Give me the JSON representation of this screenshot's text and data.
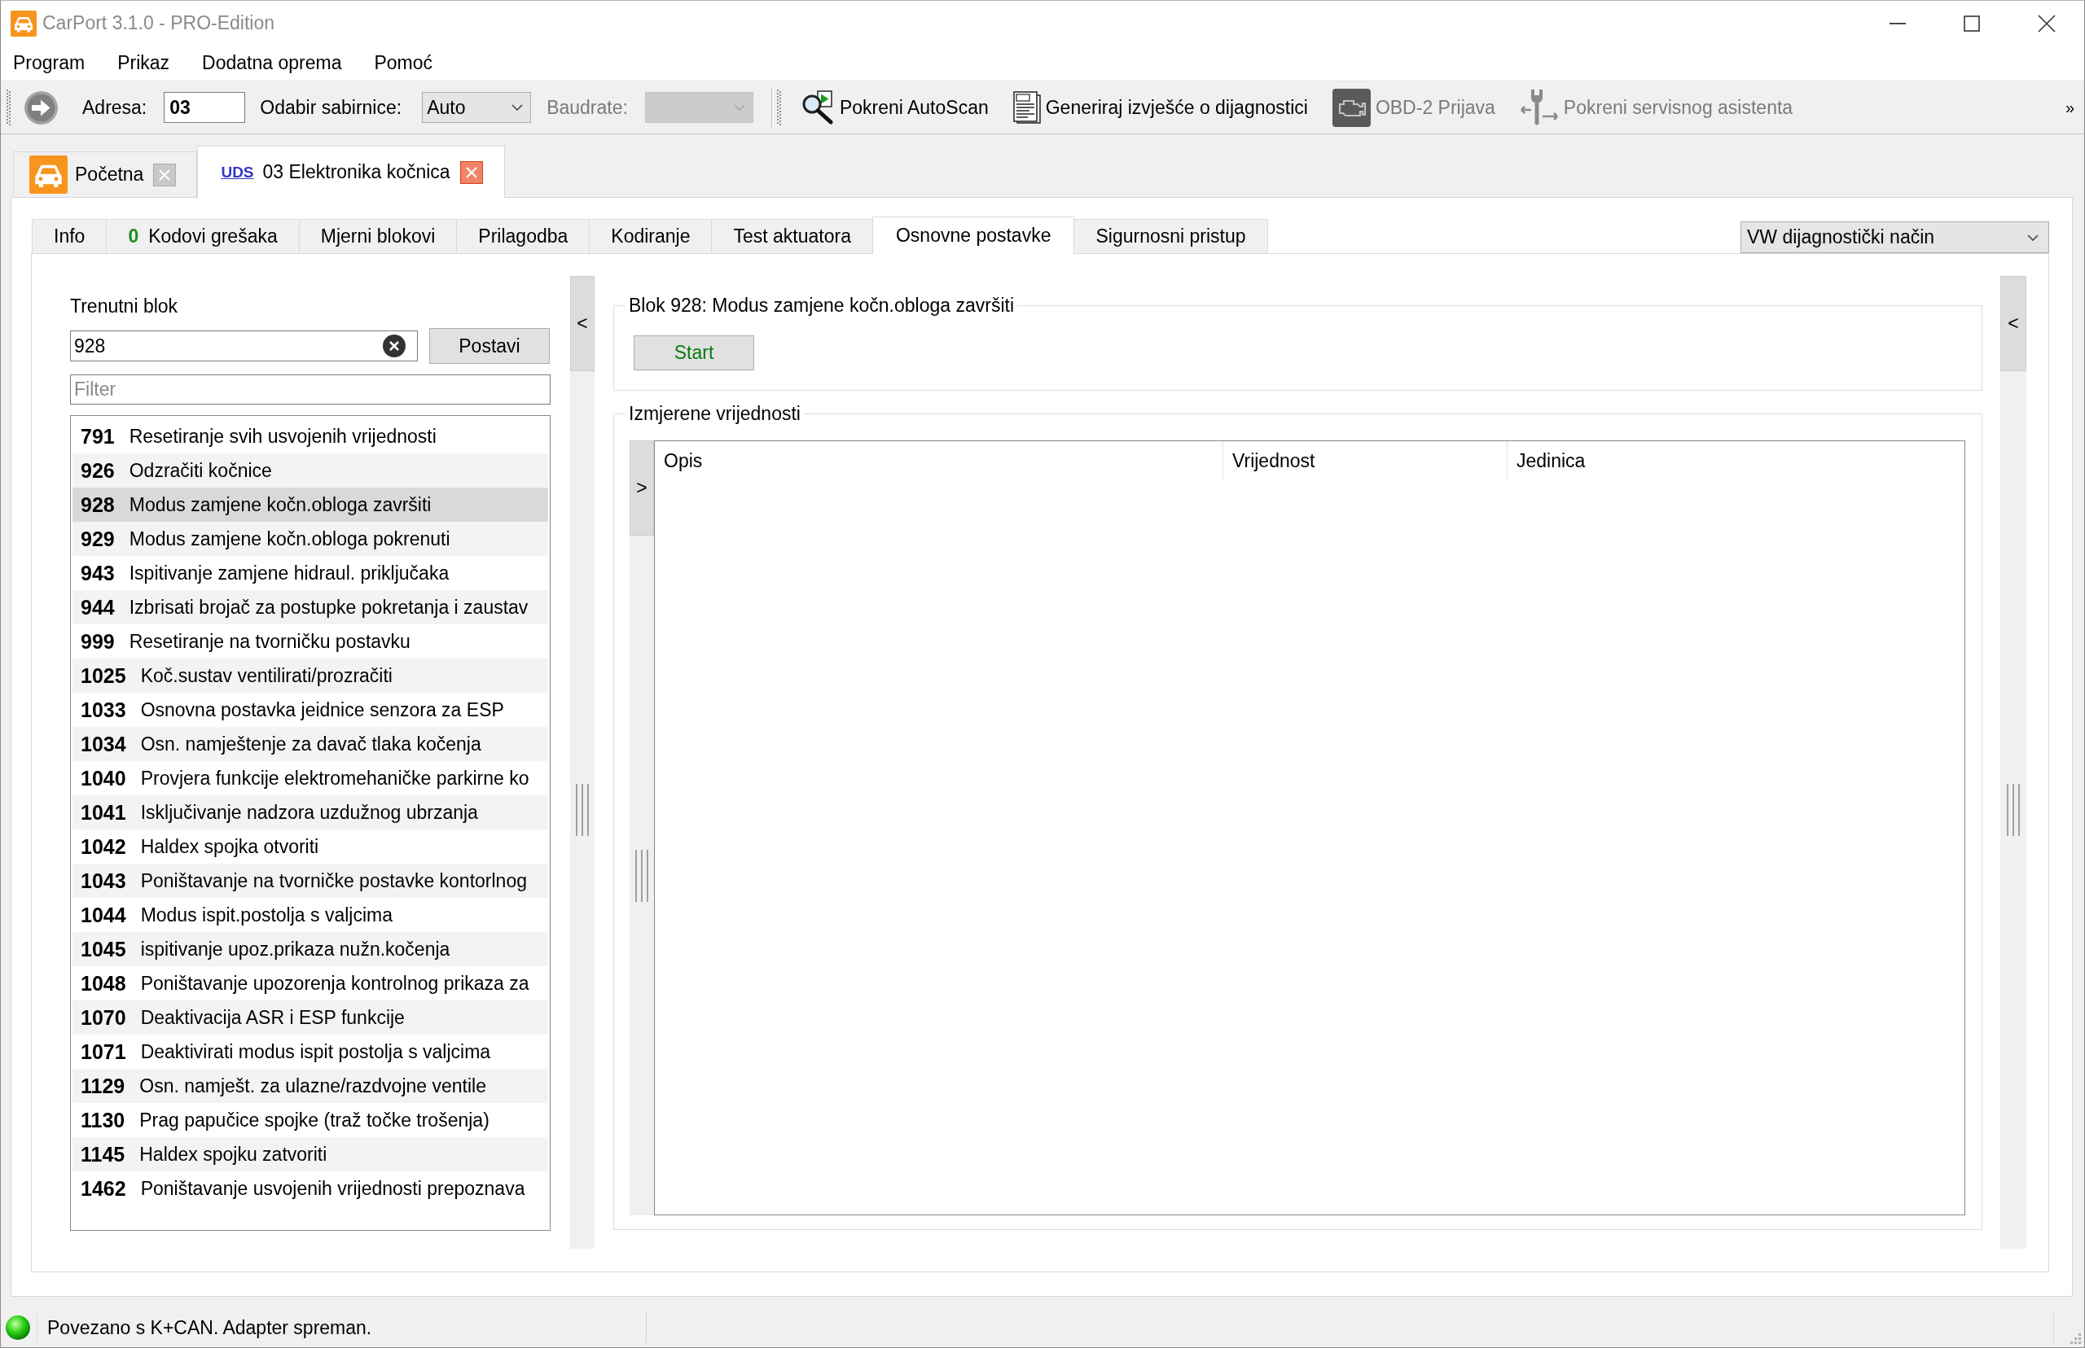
{
  "window": {
    "title": "CarPort 3.1.0 - PRO-Edition"
  },
  "menu": [
    {
      "label": "Program"
    },
    {
      "label": "Prikaz"
    },
    {
      "label": "Dodatna oprema"
    },
    {
      "label": "Pomoć"
    }
  ],
  "toolbar": {
    "address": {
      "label": "Adresa:",
      "value": "03"
    },
    "bus": {
      "label": "Odabir sabirnice:",
      "value": "Auto"
    },
    "baudrate": {
      "label": "Baudrate:",
      "disabled": true
    },
    "actions": [
      {
        "kind": "autoscan",
        "label": "Pokreni AutoScan",
        "disabled": false
      },
      {
        "kind": "report",
        "label": "Generiraj izvješće o dijagnostici",
        "disabled": false
      },
      {
        "kind": "obd",
        "label": "OBD-2 Prijava",
        "disabled": true
      },
      {
        "kind": "assistant",
        "label": "Pokreni servisnog asistenta",
        "disabled": true
      }
    ],
    "overflow": "»"
  },
  "document_tabs": [
    {
      "kind": "home",
      "label": "Početna",
      "selected": false
    },
    {
      "kind": "module",
      "badge": "UDS",
      "label": "03 Elektronika kočnica",
      "selected": true
    }
  ],
  "module_tabs": [
    {
      "label": "Info",
      "selected": false
    },
    {
      "count": "0",
      "label": "Kodovi grešaka",
      "selected": false
    },
    {
      "label": "Mjerni blokovi",
      "selected": false
    },
    {
      "label": "Prilagodba",
      "selected": false
    },
    {
      "label": "Kodiranje",
      "selected": false
    },
    {
      "label": "Test aktuatora",
      "selected": false
    },
    {
      "label": "Osnovne postavke",
      "selected": true
    },
    {
      "label": "Sigurnosni pristup",
      "selected": false
    }
  ],
  "mode_dropdown": {
    "value": "VW dijagnostički način"
  },
  "block_panel": {
    "label": "Trenutni blok",
    "value": "928",
    "set_button": "Postavi",
    "filter_placeholder": "Filter",
    "items": [
      {
        "number": "791",
        "text": "Resetiranje svih usvojenih vrijednosti",
        "selected": false
      },
      {
        "number": "926",
        "text": "Odzračiti kočnice",
        "selected": false
      },
      {
        "number": "928",
        "text": "Modus zamjene kočn.obloga završiti",
        "selected": true
      },
      {
        "number": "929",
        "text": "Modus zamjene kočn.obloga pokrenuti",
        "selected": false
      },
      {
        "number": "943",
        "text": "Ispitivanje zamjene hidraul. priključaka",
        "selected": false
      },
      {
        "number": "944",
        "text": "Izbrisati brojač za postupke pokretanja i zaustav",
        "selected": false
      },
      {
        "number": "999",
        "text": "Resetiranje na tvorničku postavku",
        "selected": false
      },
      {
        "number": "1025",
        "text": "Koč.sustav ventilirati/prozračiti",
        "selected": false
      },
      {
        "number": "1033",
        "text": "Osnovna postavka jeidnice senzora za ESP",
        "selected": false
      },
      {
        "number": "1034",
        "text": "Osn. namještenje za davač tlaka kočenja",
        "selected": false
      },
      {
        "number": "1040",
        "text": "Provjera funkcije elektromehaničke parkirne ko",
        "selected": false
      },
      {
        "number": "1041",
        "text": "Isključivanje nadzora uzdužnog ubrzanja",
        "selected": false
      },
      {
        "number": "1042",
        "text": "Haldex spojka otvoriti",
        "selected": false
      },
      {
        "number": "1043",
        "text": "Poništavanje na tvorničke postavke kontorlnog",
        "selected": false
      },
      {
        "number": "1044",
        "text": "Modus ispit.postolja s valjcima",
        "selected": false
      },
      {
        "number": "1045",
        "text": "ispitivanje upoz.prikaza nužn.kočenja",
        "selected": false
      },
      {
        "number": "1048",
        "text": "Poništavanje upozorenja kontrolnog prikaza za",
        "selected": false
      },
      {
        "number": "1070",
        "text": "Deaktivacija ASR i ESP funkcije",
        "selected": false
      },
      {
        "number": "1071",
        "text": "Deaktivirati modus ispit postolja s valjcima",
        "selected": false
      },
      {
        "number": "1129",
        "text": "Osn. namješt. za ulazne/razdvojne ventile",
        "selected": false
      },
      {
        "number": "1130",
        "text": "Prag papučice spojke (traž točke trošenja)",
        "selected": false
      },
      {
        "number": "1145",
        "text": "Haldex spojku zatvoriti",
        "selected": false
      },
      {
        "number": "1462",
        "text": "Poništavanje usvojenih vrijednosti prepoznava",
        "selected": false
      }
    ],
    "collapse_button": "<"
  },
  "block_detail": {
    "title": "Blok 928: Modus zamjene kočn.obloga završiti",
    "start_button": "Start"
  },
  "measured_values": {
    "title": "Izmjerene vrijednosti",
    "expand_button": ">",
    "columns": [
      "Opis",
      "Vrijednost",
      "Jedinica"
    ]
  },
  "right_panel": {
    "collapse_button": "<"
  },
  "status_bar": {
    "connected": true,
    "text": "Povezano s K+CAN. Adapter spreman."
  }
}
